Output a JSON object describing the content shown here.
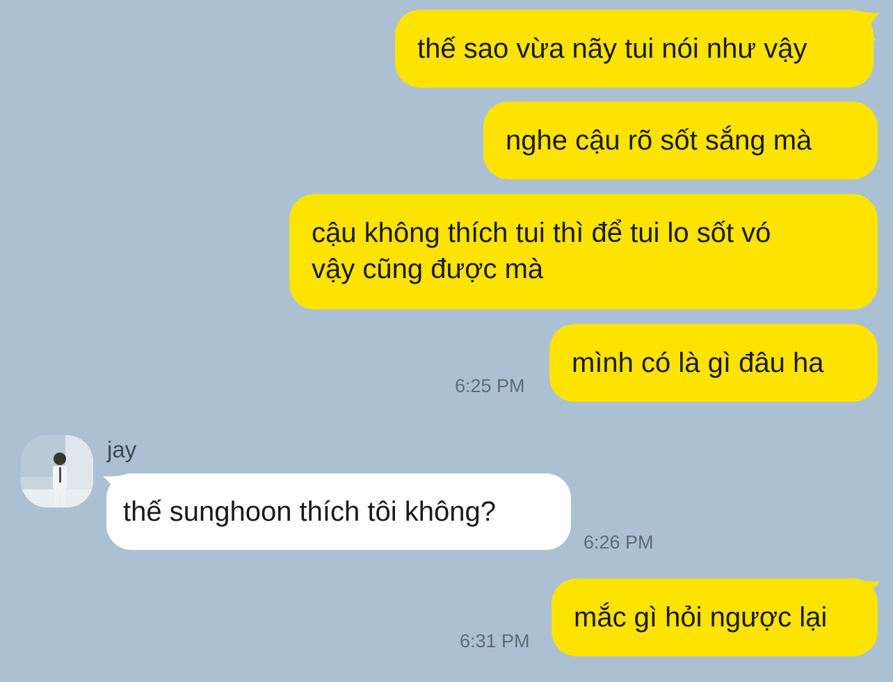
{
  "colors": {
    "background": "#abc1d3",
    "outgoing_bubble": "#fde300",
    "incoming_bubble": "#ffffff",
    "timestamp": "#5e6b75"
  },
  "messages": [
    {
      "direction": "outgoing",
      "text": "thế sao vừa nãy tui nói như vậy"
    },
    {
      "direction": "outgoing",
      "text": "nghe cậu rõ sốt sắng mà"
    },
    {
      "direction": "outgoing",
      "line1": "cậu không thích tui thì để tui lo sốt vó",
      "line2": "vậy cũng được mà"
    },
    {
      "direction": "outgoing",
      "text": "mình có là gì đâu ha",
      "time": "6:25 PM"
    },
    {
      "direction": "incoming",
      "sender": "jay",
      "avatar_icon": "profile-photo-avatar",
      "text": "thế sunghoon thích tôi không?",
      "time": "6:26 PM"
    },
    {
      "direction": "outgoing",
      "text": "mắc gì hỏi ngược lại",
      "time": "6:31 PM"
    }
  ]
}
